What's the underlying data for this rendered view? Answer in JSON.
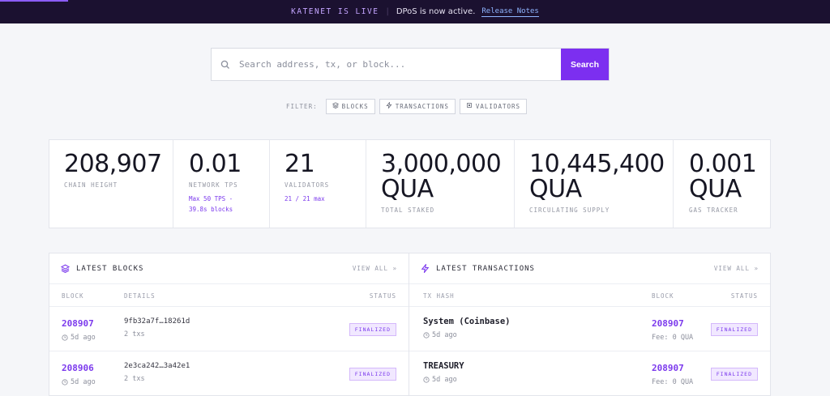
{
  "banner": {
    "live_label": "KATENET IS LIVE",
    "separator": "|",
    "message": "DPoS is now active.",
    "release_notes": "Release Notes"
  },
  "search": {
    "placeholder": "Search address, tx, or block...",
    "button_label": "Search"
  },
  "filters": {
    "label": "FILTER:",
    "items": [
      {
        "label": "BLOCKS",
        "icon": "layers-icon"
      },
      {
        "label": "TRANSACTIONS",
        "icon": "bolt-icon"
      },
      {
        "label": "VALIDATORS",
        "icon": "chip-icon"
      }
    ]
  },
  "stats": [
    {
      "value": "208,907",
      "label": "CHAIN HEIGHT"
    },
    {
      "value": "0.01",
      "label": "NETWORK TPS",
      "sub": [
        "Max 50 TPS -",
        "39.8s blocks"
      ]
    },
    {
      "value": "21",
      "label": "VALIDATORS",
      "sub": [
        "21 / 21 max"
      ]
    },
    {
      "value": [
        "3,000,000",
        "QUA"
      ],
      "label": "TOTAL STAKED"
    },
    {
      "value": [
        "10,445,400",
        "QUA"
      ],
      "label": "CIRCULATING SUPPLY"
    },
    {
      "value": [
        "0.001",
        "QUA"
      ],
      "label": "GAS TRACKER"
    }
  ],
  "latest_blocks": {
    "title": "LATEST BLOCKS",
    "view_all": "VIEW ALL »",
    "columns": [
      "BLOCK",
      "DETAILS",
      "STATUS"
    ],
    "rows": [
      {
        "block": "208907",
        "ago": "5d ago",
        "hash": "9fb32a7f…18261d",
        "txs": "2 txs",
        "status": "FINALIZED"
      },
      {
        "block": "208906",
        "ago": "5d ago",
        "hash": "2e3ca242…3a42e1",
        "txs": "2 txs",
        "status": "FINALIZED"
      }
    ]
  },
  "latest_transactions": {
    "title": "LATEST TRANSACTIONS",
    "view_all": "VIEW ALL »",
    "columns": [
      "TX HASH",
      "BLOCK",
      "STATUS"
    ],
    "rows": [
      {
        "name": "System (Coinbase)",
        "ago": "5d ago",
        "block": "208907",
        "fee": "Fee: 0 QUA",
        "status": "FINALIZED"
      },
      {
        "name": "TREASURY",
        "ago": "5d ago",
        "block": "208907",
        "fee": "Fee: 0 QUA",
        "status": "FINALIZED"
      }
    ]
  },
  "colors": {
    "accent": "#7c2ff0",
    "banner_bg": "#1b1130",
    "page_bg": "#f5f6f9"
  }
}
